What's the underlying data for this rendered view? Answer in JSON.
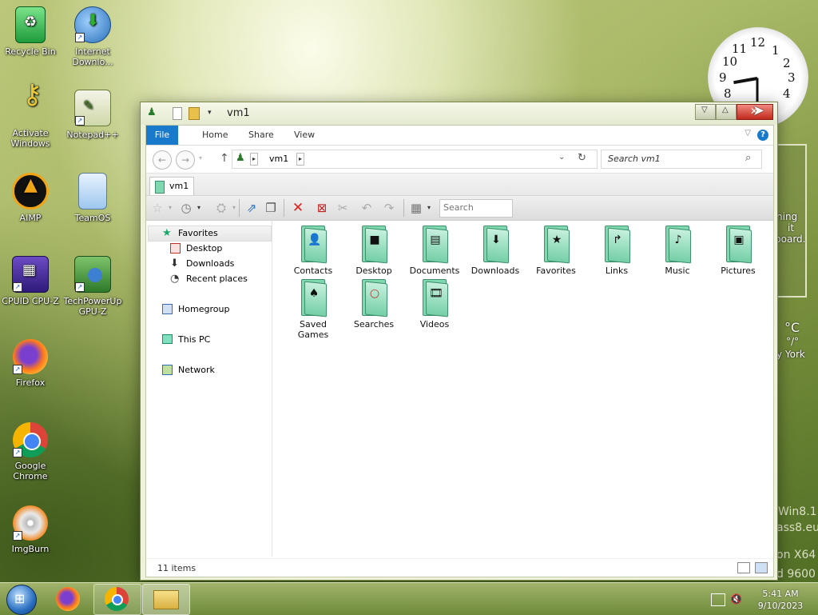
{
  "desktop": {
    "icons": [
      {
        "label": "Recycle Bin",
        "icon": "recycle-bin-icon"
      },
      {
        "label": "Internet Downlo...",
        "icon": "internet-download-manager-icon"
      },
      {
        "label": "Activate Windows",
        "icon": "key-icon"
      },
      {
        "label": "Notepad++",
        "icon": "notepad-plus-plus-icon"
      },
      {
        "label": "AIMP",
        "icon": "aimp-icon"
      },
      {
        "label": "TeamOS",
        "icon": "teamos-icon"
      },
      {
        "label": "CPUID CPU-Z",
        "icon": "cpu-z-icon"
      },
      {
        "label": "TechPowerUp GPU-Z",
        "icon": "gpu-z-icon"
      },
      {
        "label": "Firefox",
        "icon": "firefox-icon"
      },
      {
        "label": "Google Chrome",
        "icon": "chrome-icon"
      },
      {
        "label": "ImgBurn",
        "icon": "imgburn-icon"
      }
    ],
    "side_texts": {
      "line1": "ning",
      "line2": "it",
      "line3": "board.",
      "temp": "°C",
      "temp2": "°/°",
      "city": "y York",
      "corner1": "Win8.1",
      "corner2": "ass8.eu",
      "corner3": "on X64",
      "corner4": "d 9600"
    },
    "clock_numbers": [
      "12",
      "1",
      "2",
      "3",
      "4",
      "8",
      "9",
      "10",
      "11"
    ]
  },
  "window": {
    "title": "vm1",
    "ribbon_tabs": [
      "File",
      "Home",
      "Share",
      "View"
    ],
    "help": "?",
    "address": {
      "crumb": "vm1"
    },
    "search_placeholder": "Search vm1",
    "folder_tab": "vm1",
    "toolbar_search_placeholder": "Search",
    "navigation": {
      "favorites": "Favorites",
      "favorites_items": [
        "Desktop",
        "Downloads",
        "Recent places"
      ],
      "homegroup": "Homegroup",
      "this_pc": "This PC",
      "network": "Network"
    },
    "folders": [
      {
        "label": "Contacts",
        "glyph": "contact-card-glyph"
      },
      {
        "label": "Desktop",
        "glyph": "desktop-glyph"
      },
      {
        "label": "Documents",
        "glyph": "document-glyph"
      },
      {
        "label": "Downloads",
        "glyph": "download-arrow-glyph"
      },
      {
        "label": "Favorites",
        "glyph": "star-glyph"
      },
      {
        "label": "Links",
        "glyph": "link-arrow-glyph"
      },
      {
        "label": "Music",
        "glyph": "music-note-glyph"
      },
      {
        "label": "Pictures",
        "glyph": "picture-glyph"
      },
      {
        "label": "Saved Games",
        "glyph": "spade-glyph"
      },
      {
        "label": "Searches",
        "glyph": "magnifier-glyph"
      },
      {
        "label": "Videos",
        "glyph": "film-glyph"
      }
    ],
    "status": "11 items"
  },
  "taskbar": {
    "time": "5:41 AM",
    "date": "9/10/2023"
  },
  "colors": {
    "accent": "#1979ca",
    "folder_green": "#7fd8b0",
    "taskbar": "#7f9a48"
  }
}
